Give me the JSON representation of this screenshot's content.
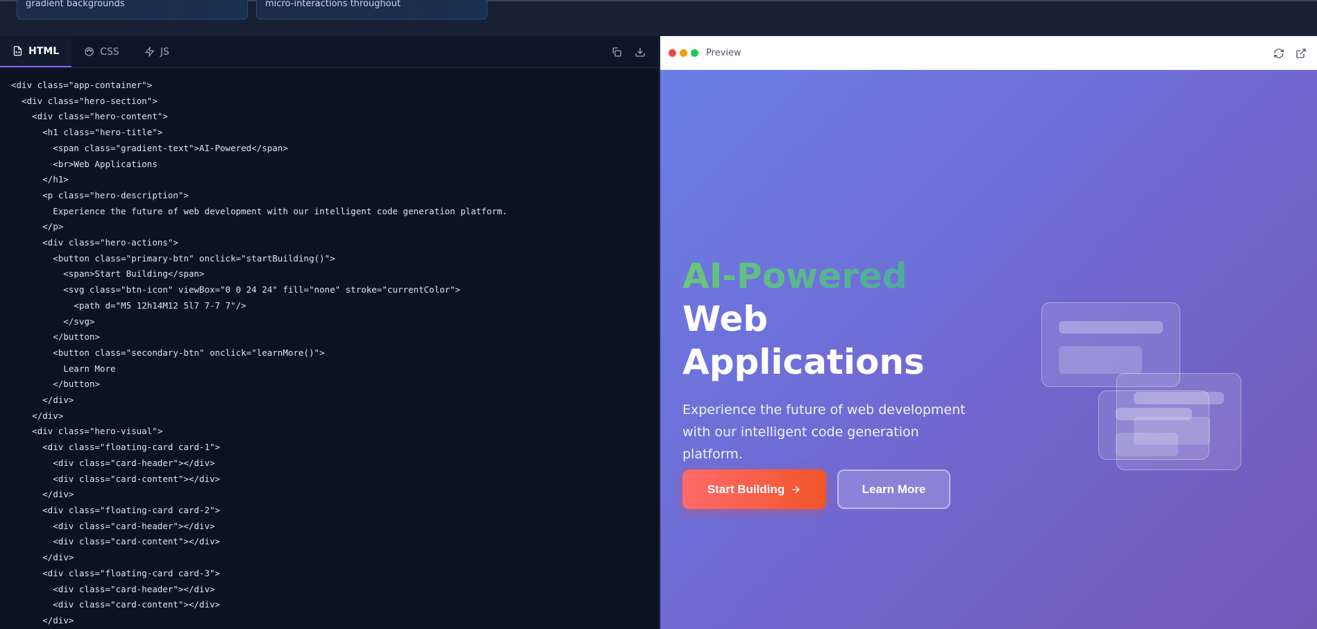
{
  "top_cards": [
    {
      "text": "gradient backgrounds"
    },
    {
      "text": "micro-interactions throughout"
    }
  ],
  "editor": {
    "tabs": [
      {
        "label": "HTML",
        "icon": "file-code-icon",
        "active": true
      },
      {
        "label": "CSS",
        "icon": "palette-icon",
        "active": false
      },
      {
        "label": "JS",
        "icon": "bolt-icon",
        "active": false
      }
    ],
    "code_lines": [
      "<div class=\"app-container\">",
      "  <div class=\"hero-section\">",
      "    <div class=\"hero-content\">",
      "      <h1 class=\"hero-title\">",
      "        <span class=\"gradient-text\">AI-Powered</span>",
      "        <br>Web Applications",
      "      </h1>",
      "      <p class=\"hero-description\">",
      "        Experience the future of web development with our intelligent code generation platform.",
      "      </p>",
      "      <div class=\"hero-actions\">",
      "        <button class=\"primary-btn\" onclick=\"startBuilding()\">",
      "          <span>Start Building</span>",
      "          <svg class=\"btn-icon\" viewBox=\"0 0 24 24\" fill=\"none\" stroke=\"currentColor\">",
      "            <path d=\"M5 12h14M12 5l7 7-7 7\"/>",
      "          </svg>",
      "        </button>",
      "        <button class=\"secondary-btn\" onclick=\"learnMore()\">",
      "          Learn More",
      "        </button>",
      "      </div>",
      "    </div>",
      "    <div class=\"hero-visual\">",
      "      <div class=\"floating-card card-1\">",
      "        <div class=\"card-header\"></div>",
      "        <div class=\"card-content\"></div>",
      "      </div>",
      "      <div class=\"floating-card card-2\">",
      "        <div class=\"card-header\"></div>",
      "        <div class=\"card-content\"></div>",
      "      </div>",
      "      <div class=\"floating-card card-3\">",
      "        <div class=\"card-header\"></div>",
      "        <div class=\"card-content\"></div>",
      "      </div>"
    ]
  },
  "preview": {
    "title": "Preview",
    "dots": [
      "#ef4444",
      "#f59e0b",
      "#22c55e"
    ],
    "hero": {
      "title_gradient": "AI-Powered",
      "title_line2": "Web",
      "title_line3": "Applications",
      "description": "Experience the future of web development with our intelligent code generation platform.",
      "primary_label": "Start Building",
      "secondary_label": "Learn More"
    }
  }
}
